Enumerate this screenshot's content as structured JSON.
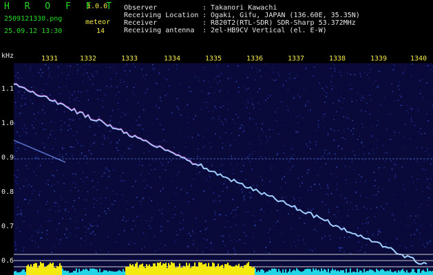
{
  "app": {
    "name": "H R O F F T",
    "version": "1.0.0"
  },
  "file": {
    "name": "2509121330.png",
    "datetime": "25.09.12 13:30"
  },
  "meteor": {
    "label": "meteor",
    "count": "14"
  },
  "info": [
    {
      "key": "Observer",
      "value": ": Takanori Kawachi"
    },
    {
      "key": "Receiving Location",
      "value": ": Ogaki, Gifu, JAPAN (136.60E, 35.35N)"
    },
    {
      "key": "Receiver",
      "value": ": R820T2(RTL-SDR) SDR-Sharp 53.372MHz"
    },
    {
      "key": "Receiving antenna",
      "value": ": 2el-HB9CV Vertical (el. E-W)"
    }
  ],
  "axis": {
    "x_ticks": [
      "1331",
      "1332",
      "1333",
      "1334",
      "1335",
      "1336",
      "1337",
      "1338",
      "1339",
      "1340"
    ],
    "y_unit": "kHz",
    "y_ticks": [
      "1.1",
      "1.0",
      "0.9",
      "0.8",
      "0.7",
      "0.6"
    ]
  },
  "colors": {
    "background": "#000000",
    "spectrogram_bg": "#0a0a3a",
    "text_green": "#22dd22",
    "text_yellow": "#f4e84a"
  }
}
